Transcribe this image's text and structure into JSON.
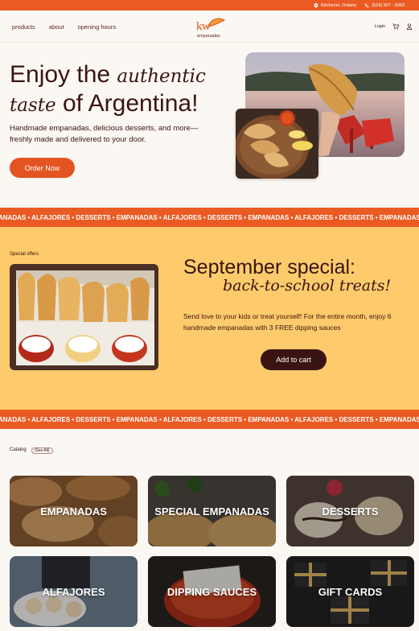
{
  "topbar": {
    "location": "Kitchener, Ontario",
    "phone": "(519) 507 - 8353"
  },
  "nav": {
    "links": [
      "products",
      "about",
      "opening hours"
    ],
    "logo_main": "kw",
    "logo_sub": "empanadas",
    "login": "Login"
  },
  "hero": {
    "title_line1_a": "Enjoy the ",
    "title_script1": "authentic",
    "title_script2": "taste",
    "title_line2_b": " of Argentina!",
    "subtitle": "Handmade empanadas, delicious desserts, and more—freshly made and delivered to your door.",
    "cta": "Order Now"
  },
  "ticker": {
    "text": "ANADAS • ALFAJORES • DESSERTS • EMPANADAS • ALFAJORES • DESSERTS • EMPANADAS • ALFAJORES • DESSERTS • EMPANADAS • ALFAJORES • DESSERTS • EMPANADAS • ALFAJORES • DE"
  },
  "special": {
    "label": "Special offers",
    "title": "September special:",
    "script": "back-to-school treats!",
    "description": "Send love to your kids or treat yourself! For the entire month, enjoy 6 handmade empanadas with 3 FREE dipping sauces",
    "cta": "Add to cart"
  },
  "catalog": {
    "heading": "Catalog",
    "see_all": "(See All)",
    "tiles": [
      "EMPANADAS",
      "SPECIAL EMPANADAS",
      "DESSERTS",
      "ALFAJORES",
      "DIPPING SAUCES",
      "GIFT CARDS"
    ]
  },
  "colors": {
    "accent": "#ea5b24",
    "dark": "#3a1414",
    "special_bg": "#fdcb6b",
    "page_bg": "#fbf7f2"
  }
}
